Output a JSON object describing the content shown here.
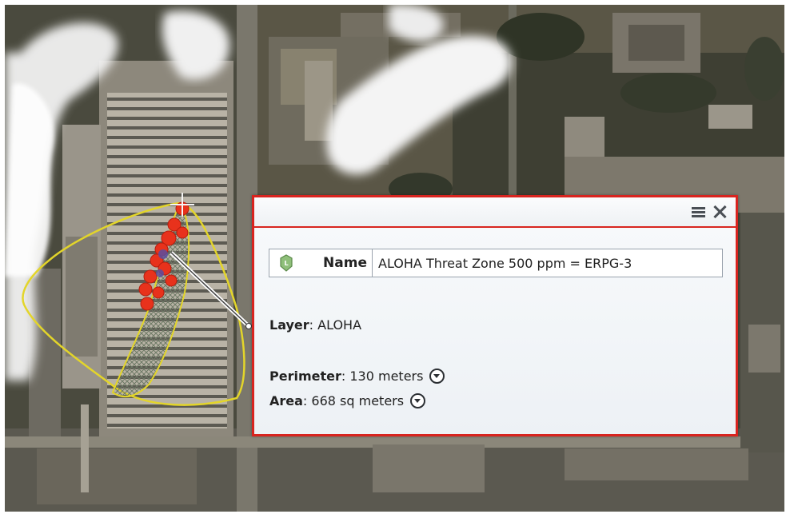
{
  "popup": {
    "name_label": "Name",
    "name_value": "ALOHA Threat Zone 500 ppm = ERPG-3",
    "layer_label": "Layer",
    "layer_value": "ALOHA",
    "perimeter_label": "Perimeter",
    "perimeter_value": "130 meters",
    "area_label": "Area",
    "area_value": "668 sq meters"
  },
  "icons": {
    "menu": "hamburger-menu-icon",
    "close": "close-icon",
    "layer_symbol": "layer-symbol-icon",
    "dropdown": "chevron-down-circle-icon"
  },
  "colors": {
    "popup_border": "#d8241f",
    "threat_zone_outline": "#e3d52a",
    "source_marker": "#e8321c",
    "plume_smoke": "#f2f2f2"
  }
}
